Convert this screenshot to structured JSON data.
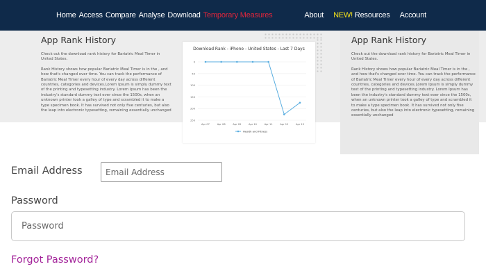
{
  "nav": {
    "left": [
      {
        "label": "Home",
        "color": "#ffffff"
      },
      {
        "label": "Access",
        "color": "#ffffff"
      },
      {
        "label": "Compare",
        "color": "#ffffff"
      },
      {
        "label": "Analyse",
        "color": "#ffffff"
      },
      {
        "label": "Download",
        "color": "#ffffff"
      },
      {
        "label": "Temporary Measures",
        "color": "#e0253b"
      }
    ],
    "about": "About",
    "new_badge": "NEW!",
    "resources": "Resources",
    "account": "Account"
  },
  "rank_left": {
    "title": "App Rank History",
    "intro": "Check out the download rank history for Bariatric Meal Timer in United States.",
    "body": "Rank History shows how popular Bariatric Meal Timer is in the , and how that's changed over time. You can track the performance of Bariatric Meal Timer every hour of every day across different countries, categories and devices.Lorem Ipsum is simply dummy text of the printing and typesetting industry. Lorem Ipsum has been the industry's standard dummy text ever since the 1500s, when an unknown printer took a galley of type and scrambled it to make a type specimen book. It has survived not only five centuries, but also the leap into electronic typesetting, remaining essentially unchanged"
  },
  "rank_right": {
    "title": "App Rank History",
    "intro": "Check out the download rank history for Bariatric Meal Timer in United States.",
    "body": "Rank History shows how popular Bariatric Meal Timer is in the , and how that's changed over time. You can track the performance of Bariatric Meal Timer every hour of every day across different countries, categories and devices.Lorem Ipsum is simply dummy text of the printing and typesetting industry. Lorem Ipsum has been the industry's standard dummy text ever since the 1500s, when an unknown printer took a galley of type and scrambled it to make a type specimen book. It has survived not only five centuries, but also the leap into electronic typesetting, remaining essentially unchanged"
  },
  "chart_data": {
    "type": "line",
    "title": "Download Rank - iPhone - United States - Last 7 Days",
    "xlabel": "",
    "ylabel": "",
    "categories": [
      "Apr 07",
      "Apr 08",
      "Apr 09",
      "Apr 10",
      "Apr 11",
      "Apr 12",
      "Apr 13"
    ],
    "y_ticks": [
      0,
      50,
      100,
      150,
      200,
      250
    ],
    "ylim": [
      0,
      250
    ],
    "y_reversed": true,
    "grid": true,
    "legend": "bottom",
    "series": [
      {
        "name": "Health and Fitness",
        "color": "#5aaee0",
        "values": [
          0,
          0,
          0,
          0,
          0,
          225,
          175
        ]
      }
    ]
  },
  "form": {
    "email_label": "Email Address",
    "email_placeholder": "Email Address",
    "password_label": "Password",
    "password_placeholder": "Password",
    "forgot_link": "Forgot Password?"
  }
}
